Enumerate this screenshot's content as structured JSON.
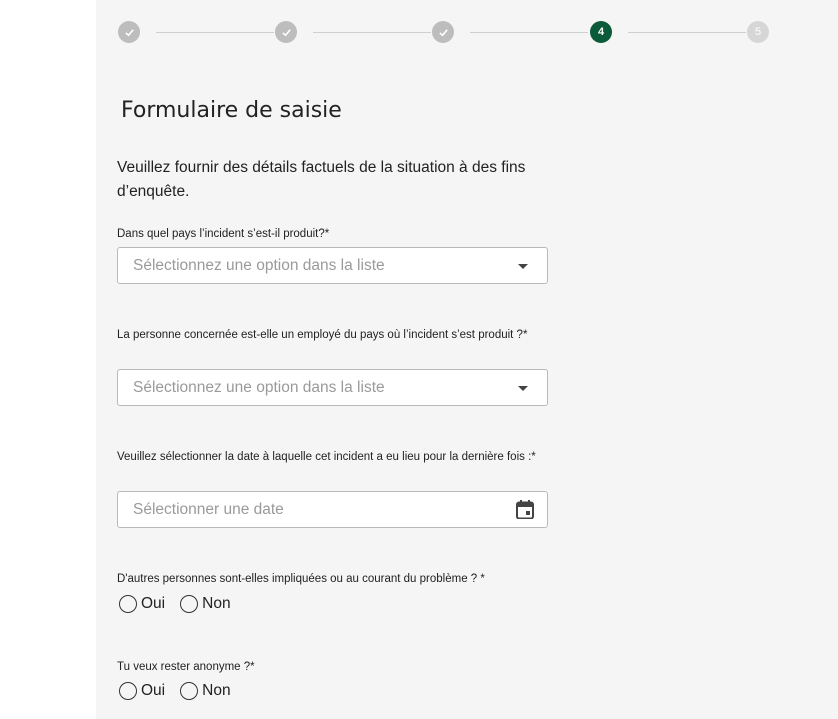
{
  "stepper": {
    "steps": [
      {
        "label": "",
        "state": "done"
      },
      {
        "label": "",
        "state": "done"
      },
      {
        "label": "",
        "state": "done"
      },
      {
        "label": "4",
        "state": "active"
      },
      {
        "label": "5",
        "state": "upcoming"
      }
    ]
  },
  "form": {
    "title": "Formulaire de saisie",
    "intro": "Veuillez fournir des détails factuels de la situation à des fins d’enquête.",
    "country_label": "Dans quel pays l’incident s’est-il produit?*",
    "country_placeholder": "Sélectionnez une option dans la liste",
    "employee_label": "La personne concernée est-elle un employé du pays où l’incident s’est produit ?*",
    "employee_placeholder": "Sélectionnez une option dans la liste",
    "date_label": "Veuillez sélectionner la date à laquelle cet incident a eu lieu pour la dernière fois :*",
    "date_placeholder": "Sélectionner une date",
    "others_label": "D'autres personnes sont-elles impliquées ou au courant du problème ? *",
    "anonymous_label": "Tu veux rester anonyme ?*",
    "yes": "Oui",
    "no": "Non"
  },
  "colors": {
    "active_step": "#0b5a3a",
    "done_step": "#bdbdbd",
    "panel_bg": "#f5f5f5"
  }
}
